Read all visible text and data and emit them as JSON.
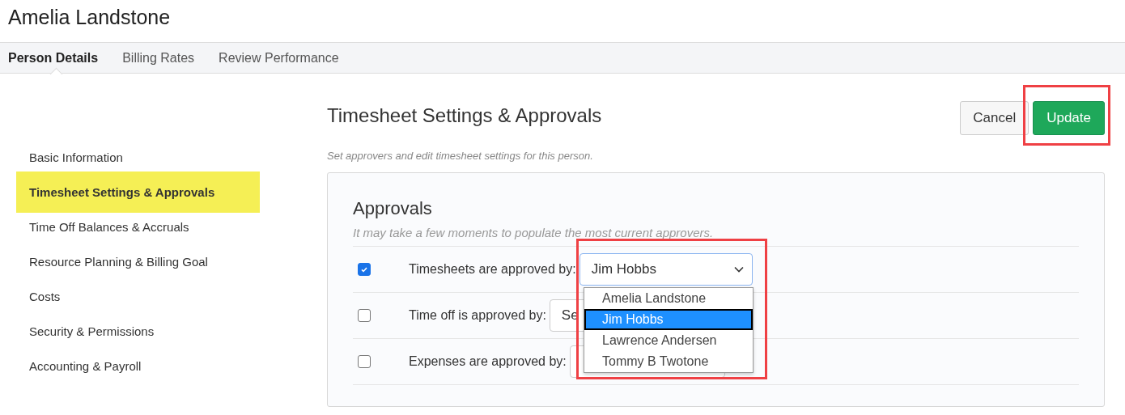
{
  "page_title": "Amelia Landstone",
  "tabs": [
    {
      "label": "Person Details",
      "selected": true
    },
    {
      "label": "Billing Rates",
      "selected": false
    },
    {
      "label": "Review Performance",
      "selected": false
    }
  ],
  "sidebar": {
    "items": [
      {
        "label": "Basic Information",
        "highlighted": false
      },
      {
        "label": "Timesheet Settings & Approvals",
        "highlighted": true
      },
      {
        "label": "Time Off Balances & Accruals",
        "highlighted": false
      },
      {
        "label": "Resource Planning & Billing Goal",
        "highlighted": false
      },
      {
        "label": "Costs",
        "highlighted": false
      },
      {
        "label": "Security & Permissions",
        "highlighted": false
      },
      {
        "label": "Accounting & Payroll",
        "highlighted": false
      }
    ]
  },
  "section": {
    "title": "Timesheet Settings & Approvals",
    "subtitle": "Set approvers and edit timesheet settings for this person.",
    "buttons": [
      {
        "label": "Cancel",
        "kind": "secondary",
        "outlined": false
      },
      {
        "label": "Update",
        "kind": "primary",
        "outlined": true
      }
    ]
  },
  "approvals": {
    "title": "Approvals",
    "hint": "It may take a few moments to populate the most current approvers.",
    "rows": [
      {
        "label": "Timesheets are approved by:",
        "checked": true,
        "value": "Jim Hobbs",
        "open": true
      },
      {
        "label": "Time off is approved by:",
        "checked": false,
        "value": "Se",
        "open": false
      },
      {
        "label": "Expenses are approved by:",
        "checked": false,
        "open": false
      }
    ],
    "dropdown": {
      "outlined": true,
      "options": [
        {
          "label": "Amelia Landstone",
          "selected": false
        },
        {
          "label": "Jim Hobbs",
          "selected": true
        },
        {
          "label": "Lawrence Andersen",
          "selected": false
        },
        {
          "label": "Tommy B Twotone",
          "selected": false
        }
      ]
    }
  }
}
